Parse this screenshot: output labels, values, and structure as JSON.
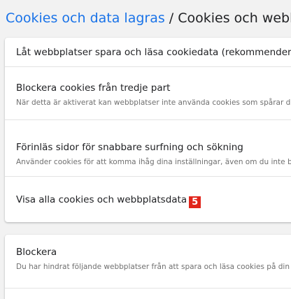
{
  "breadcrumb": {
    "parent": "Cookies och data lagras",
    "separator": "/",
    "current": "Cookies och webbplatsdata"
  },
  "settings": [
    {
      "title": "Låt webbplatser spara och läsa cookiedata (rekommenderas)",
      "description": ""
    },
    {
      "title": "Blockera cookies från tredje part",
      "description": "När detta är aktiverat kan webbplatser inte använda cookies som spårar dig över webben."
    },
    {
      "title": "Förinläs sidor för snabbare surfning och sökning",
      "description": "Använder cookies för att komma ihåg dina inställningar, även om du inte besöker sidorna"
    },
    {
      "title": "Visa alla cookies och webbplatsdata",
      "description": "",
      "badge": "5"
    }
  ],
  "block_section": {
    "title": "Blockera",
    "description": "Du har hindrat följande webbplatser från att spara och läsa cookies på din enhet"
  },
  "colors": {
    "accent": "#1a73e8",
    "badge": "#e1251b",
    "background": "#f2f2f2"
  }
}
